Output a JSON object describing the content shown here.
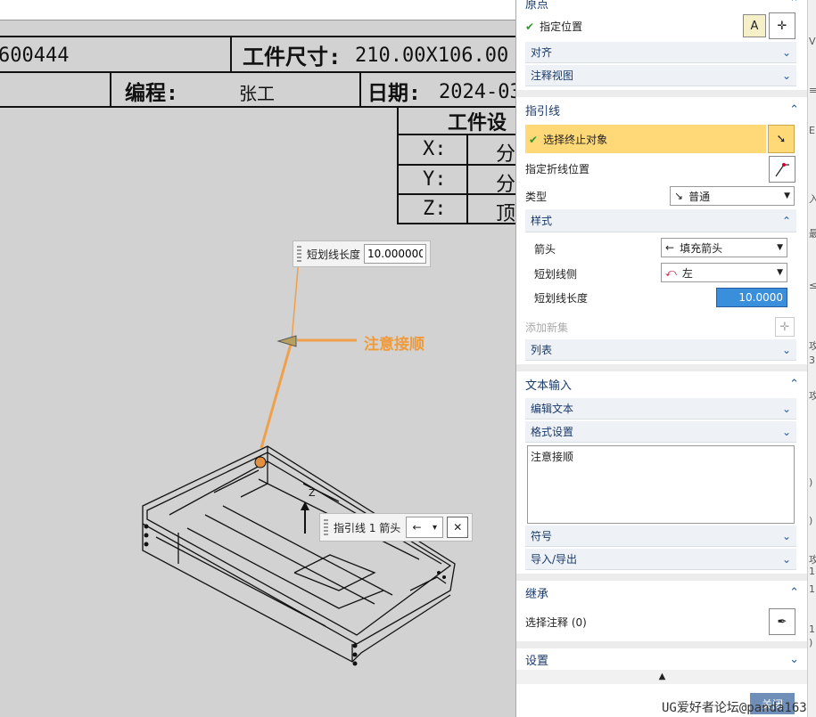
{
  "titleblock": {
    "part_no": "600444",
    "size_label": "工件尺寸:",
    "size_value": "210.00X106.00",
    "prog_label": "编程:",
    "prog_value": "张工",
    "date_label": "日期:",
    "date_value": "2024-03",
    "setup_label": "工件设",
    "x_label": "X:",
    "x_value": "分",
    "y_label": "Y:",
    "y_value": "分",
    "z_label": "Z:",
    "z_value": "顶"
  },
  "callouts": {
    "stub_label": "短划线长度",
    "stub_value": "10.000000",
    "leader_label": "指引线 1 箭头",
    "leader_arrow": "←",
    "leader_caret": "▾"
  },
  "note_text": "注意接顺",
  "panel": {
    "origin_title": "原点",
    "specify_location": "指定位置",
    "align": "对齐",
    "annotation_view": "注释视图",
    "leader_title": "指引线",
    "select_terminate": "选择终止对象",
    "specify_jog": "指定折线位置",
    "type_label": "类型",
    "type_value": "普通",
    "style_title": "样式",
    "arrow_label": "箭头",
    "arrow_value": "填充箭头",
    "stub_side_label": "短划线侧",
    "stub_side_value": "左",
    "stub_len_label": "短划线长度",
    "stub_len_value": "10.0000",
    "add_set": "添加新集",
    "list": "列表",
    "text_input_title": "文本输入",
    "edit_text": "编辑文本",
    "format_settings": "格式设置",
    "text_value": "注意接顺",
    "symbol": "符号",
    "import_export": "导入/导出",
    "inherit_title": "继承",
    "select_annotation": "选择注释 (0)",
    "settings_title": "设置",
    "ok_button": "关闭"
  },
  "watermark": "UG爱好者论坛@panda163",
  "colors": {
    "leader": "#f0a04a",
    "highlight": "#ffd878",
    "accent": "#2a5aa0"
  }
}
